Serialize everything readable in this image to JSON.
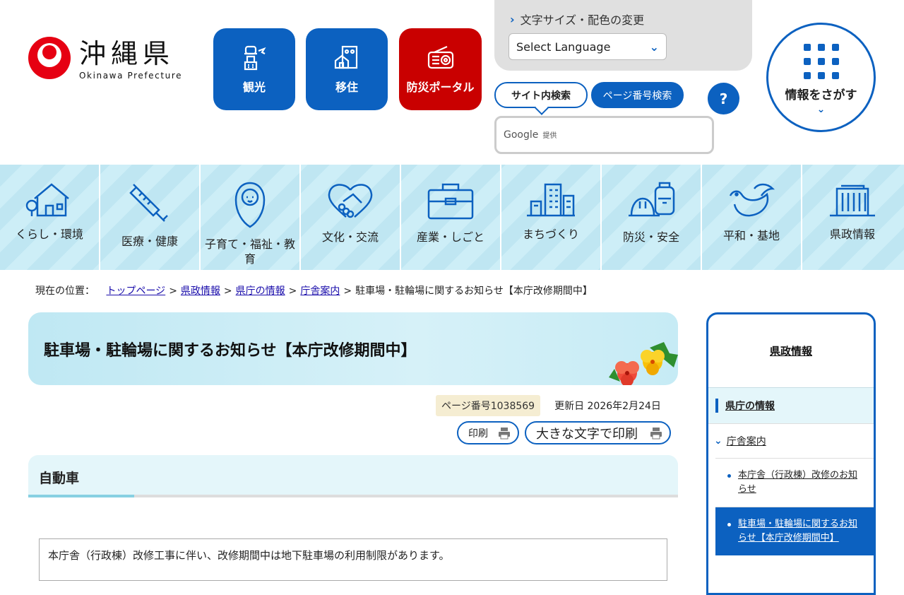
{
  "header": {
    "logo_jp": "沖縄県",
    "logo_en": "Okinawa Prefecture",
    "btn_kanko": "観光",
    "btn_iju": "移住",
    "btn_bousai": "防災ポータル",
    "font_color_link": "文字サイズ・配色の変更",
    "select_language": "Select Language",
    "tab_site_search": "サイト内検索",
    "tab_page_search": "ページ番号検索",
    "help": "?",
    "google": "Google",
    "google_provided": "提供",
    "find_info": "情報をさがす"
  },
  "nav": [
    {
      "label": "くらし・環境",
      "icon": "house-icon"
    },
    {
      "label": "医療・健康",
      "icon": "syringe-icon"
    },
    {
      "label": "子育て・福祉・教育",
      "icon": "baby-icon"
    },
    {
      "label": "文化・交流",
      "icon": "handshake-icon"
    },
    {
      "label": "産業・しごと",
      "icon": "briefcase-icon"
    },
    {
      "label": "まちづくり",
      "icon": "buildings-icon"
    },
    {
      "label": "防災・安全",
      "icon": "helmet-icon"
    },
    {
      "label": "平和・基地",
      "icon": "dove-icon"
    },
    {
      "label": "県政情報",
      "icon": "office-building-icon"
    }
  ],
  "breadcrumb": {
    "lead": "現在の位置：",
    "links": [
      "トップページ",
      "県政情報",
      "県庁の情報",
      "庁舎案内"
    ],
    "separator": ">",
    "current": "駐車場・駐輪場に関するお知らせ【本庁改修期間中】"
  },
  "main": {
    "title": "駐車場・駐輪場に関するお知らせ【本庁改修期間中】",
    "page_number": "ページ番号1038569",
    "updated": "更新日 2026年2月24日",
    "print": "印刷",
    "print_large": "大きな文字で印刷",
    "section_heading": "自動車",
    "body_text": "本庁舎（行政棟）改修工事に伴い、改修期間中は地下駐車場の利用制限があります。"
  },
  "sidebar": {
    "heading": "県政情報",
    "level1": "県庁の情報",
    "level2": "庁舎案内",
    "items": [
      {
        "label": "本庁舎（行政棟）改修のお知らせ",
        "active": false
      },
      {
        "label": "駐車場・駐輪場に関するお知らせ【本庁改修期間中】",
        "active": true
      }
    ]
  },
  "colors": {
    "brand_blue": "#0c61c0",
    "disaster_red": "#c90000",
    "logo_red": "#e60012",
    "nav_bg": "#bfe6f2"
  }
}
